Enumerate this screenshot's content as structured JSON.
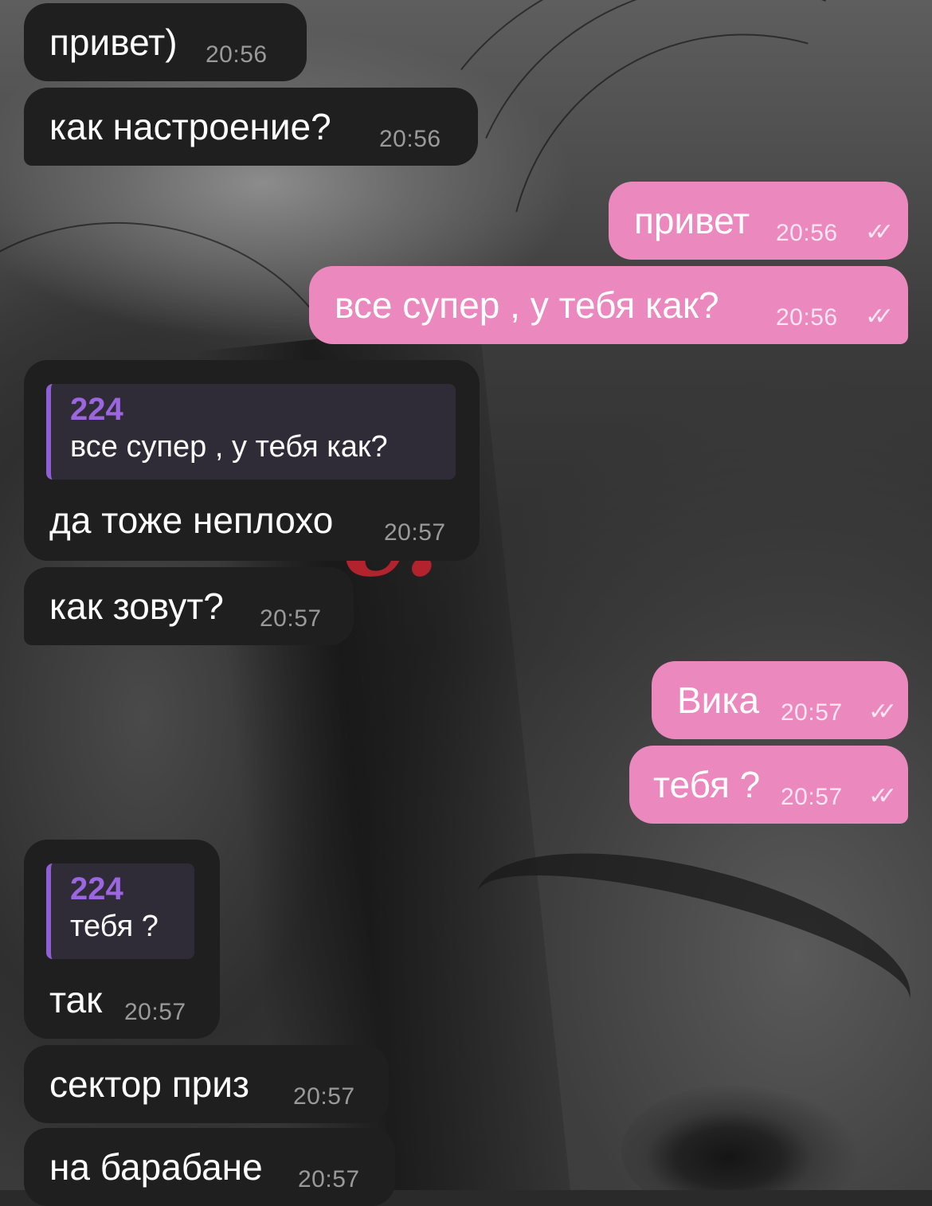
{
  "messages": [
    {
      "direction": "in",
      "text": "привет)",
      "time": "20:56"
    },
    {
      "direction": "in",
      "text": "как настроение?",
      "time": "20:56"
    },
    {
      "direction": "out",
      "text": "привет",
      "time": "20:56",
      "status": "read"
    },
    {
      "direction": "out",
      "text": "все супер , у тебя как?",
      "time": "20:56",
      "status": "read"
    },
    {
      "direction": "in",
      "reply": {
        "name": "224",
        "text": "все супер , у тебя как?"
      },
      "text": "да тоже неплохо",
      "time": "20:57"
    },
    {
      "direction": "in",
      "text": "как зовут?",
      "time": "20:57"
    },
    {
      "direction": "out",
      "text": "Вика",
      "time": "20:57",
      "status": "read"
    },
    {
      "direction": "out",
      "text": "тебя ?",
      "time": "20:57",
      "status": "read"
    },
    {
      "direction": "in",
      "reply": {
        "name": "224",
        "text": "тебя ?"
      },
      "text": "так",
      "time": "20:57"
    },
    {
      "direction": "in",
      "text": "сектор приз",
      "time": "20:57"
    },
    {
      "direction": "in",
      "text": "на барабане",
      "time": "20:57"
    }
  ],
  "wallpaper": {
    "logo_text": "e."
  },
  "icons": {
    "read_receipt": "double-check-icon"
  },
  "colors": {
    "incoming_bubble": "#1f1f1f",
    "outgoing_bubble": "#eb89bf",
    "reply_accent": "#8f5fd6",
    "reply_name": "#9b66e0",
    "logo": "#b3232e"
  }
}
